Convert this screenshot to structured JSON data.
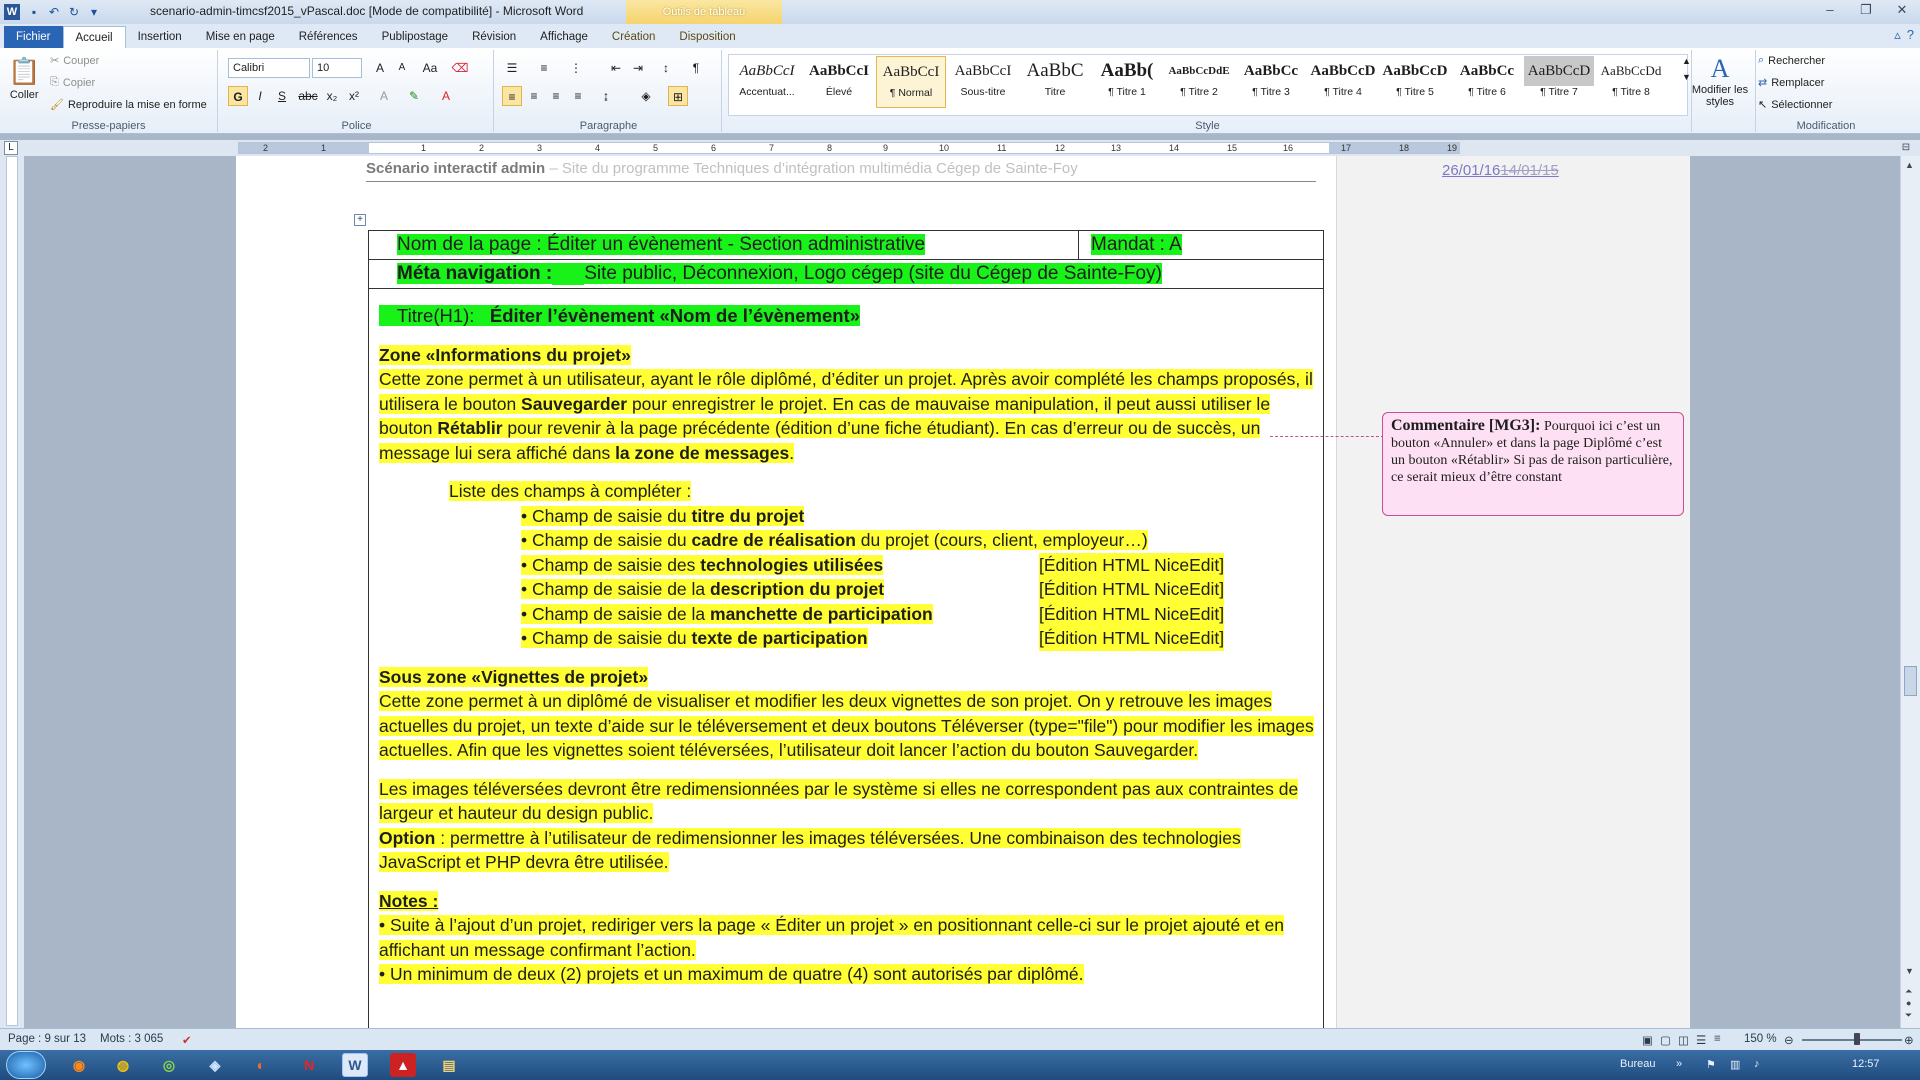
{
  "titlebar": {
    "doc_title": "scenario-admin-timcsf2015_vPascal.doc [Mode de compatibilité] - Microsoft Word",
    "context_tab_group": "Outils de tableau",
    "word_logo": "W"
  },
  "tabs": [
    "Fichier",
    "Accueil",
    "Insertion",
    "Mise en page",
    "Références",
    "Publipostage",
    "Révision",
    "Affichage",
    "Création",
    "Disposition"
  ],
  "ribbon": {
    "clipboard": {
      "paste": "Coller",
      "cut": "Couper",
      "copy": "Copier",
      "format_painter": "Reproduire la mise en forme",
      "label": "Presse-papiers"
    },
    "font": {
      "name": "Calibri",
      "size": "10",
      "label": "Police"
    },
    "paragraph": {
      "label": "Paragraphe"
    },
    "styles": {
      "label": "Style",
      "items": [
        {
          "sample": "AaBbCcI",
          "name": "Accentuat..."
        },
        {
          "sample": "AaBbCcI",
          "name": "Élevé"
        },
        {
          "sample": "AaBbCcI",
          "name": "¶ Normal"
        },
        {
          "sample": "AaBbCcI",
          "name": "Sous-titre"
        },
        {
          "sample": "AaBbC",
          "name": "Titre"
        },
        {
          "sample": "AaBb(",
          "name": "¶ Titre 1"
        },
        {
          "sample": "AaBbCcDdE",
          "name": "¶ Titre 2"
        },
        {
          "sample": "AaBbCc",
          "name": "¶ Titre 3"
        },
        {
          "sample": "AaBbCcD",
          "name": "¶ Titre 4"
        },
        {
          "sample": "AaBbCcD",
          "name": "¶ Titre 5"
        },
        {
          "sample": "AaBbCc",
          "name": "¶ Titre 6"
        },
        {
          "sample": "AaBbCcD",
          "name": "¶ Titre 7"
        },
        {
          "sample": "AaBbCcDd",
          "name": "¶ Titre 8"
        }
      ],
      "modify": "Modifier les styles"
    },
    "editing": {
      "find": "Rechercher",
      "replace": "Remplacer",
      "select": "Sélectionner",
      "label": "Modification"
    }
  },
  "ruler_numbers": [
    "2",
    "1",
    "1",
    "2",
    "3",
    "4",
    "5",
    "6",
    "7",
    "8",
    "9",
    "10",
    "11",
    "12",
    "13",
    "14",
    "15",
    "16",
    "17",
    "18",
    "19"
  ],
  "document": {
    "header_title": "Scénario interactif admin",
    "header_subtitle": " – Site du programme Techniques d’intégration multimédia Cégep de Sainte-Foy",
    "header_date_new": "26/01/16",
    "header_date_old": "14/01/15",
    "table": {
      "page_name": "Nom de la page : Éditer un évènement - Section administrative",
      "mandat": "Mandat : A",
      "meta_nav_label": "Méta navigation :",
      "meta_nav_value": "Site public, Déconnexion, Logo cégep (site du Cégep de Sainte-Foy)"
    },
    "h1_label": "Titre(H1):",
    "h1_value": "Éditer l’évènement «Nom de l’évènement»",
    "zone1_title": "Zone «Informations du projet»",
    "zone1_p1": "Cette zone permet à un utilisateur, ayant le rôle diplômé, d’éditer un projet. Après avoir complété les champs proposés, il utilisera le bouton ",
    "zone1_save": "Sauvegarder",
    "zone1_p2": " pour enregistrer le projet. En cas de mauvaise manipulation, il peut aussi utiliser le bouton ",
    "zone1_reset": "Rétablir",
    "zone1_p3": " pour revenir à la page précédente (édition d’une fiche étudiant). En cas d’erreur ou de succès, un message lui sera affiché dans ",
    "zone1_msgzone": "la zone de messages",
    "list_intro": "Liste des champs à compléter :",
    "fields": [
      {
        "pre": "• Champ de saisie du ",
        "bold": "titre du projet",
        "post": "",
        "tag": ""
      },
      {
        "pre": "• Champ de saisie du ",
        "bold": "cadre de réalisation",
        "post": " du projet (cours, client, employeur…)",
        "tag": ""
      },
      {
        "pre": "• Champ de saisie des ",
        "bold": "technologies utilisées",
        "post": "",
        "tag": "[Édition HTML NiceEdit]"
      },
      {
        "pre": "• Champ de saisie de la ",
        "bold": "description du projet",
        "post": "",
        "tag": "[Édition HTML NiceEdit]"
      },
      {
        "pre": "• Champ de saisie de la ",
        "bold": "manchette de participation",
        "post": "",
        "tag": "[Édition HTML NiceEdit]"
      },
      {
        "pre": "• Champ de saisie du ",
        "bold": "texte de participation",
        "post": "",
        "tag": "[Édition HTML NiceEdit]"
      }
    ],
    "zone2_title": "Sous zone «Vignettes de projet»",
    "zone2_text": "Cette zone permet à un diplômé de visualiser et modifier les deux vignettes de son projet. On y retrouve les images actuelles du projet, un texte d’aide sur le téléversement et deux boutons Téléverser (type=\"file\") pour modifier les images actuelles. Afin que les vignettes soient téléversées, l’utilisateur doit lancer l’action du bouton Sauvegarder.",
    "resize_text": "Les images téléversées devront être redimensionnées par le système si elles ne correspondent pas aux contraintes de largeur et hauteur du design public.",
    "option_label": "Option",
    "option_text": " : permettre à l’utilisateur de redimensionner les images téléversées. Une combinaison des technologies JavaScript et PHP devra être utilisée.",
    "notes_title": "Notes :",
    "note1": "• Suite à l’ajout d’un projet, rediriger vers la page « Éditer un projet » en positionnant celle-ci sur le projet ajouté et en affichant un message confirmant l’action.",
    "note2": "• Un minimum de deux (2) projets et un maximum de quatre (4) sont autorisés par diplômé."
  },
  "comment": {
    "label": "Commentaire [MG3]:",
    "text": " Pourquoi ici c’est un bouton «Annuler» et dans la page Diplômé c’est un bouton «Rétablir» Si pas de raison particulière, ce serait mieux d’être constant"
  },
  "statusbar": {
    "page": "Page : 9 sur 13",
    "words": "Mots : 3 065",
    "zoom": "150 %"
  },
  "taskbar": {
    "desktop_label": "Bureau",
    "clock": "12:57"
  },
  "colors": {
    "highlight_yellow": "#ffff33",
    "highlight_green": "#19f219",
    "comment_bg": "#fde0f3",
    "accent": "#2a64b4"
  }
}
